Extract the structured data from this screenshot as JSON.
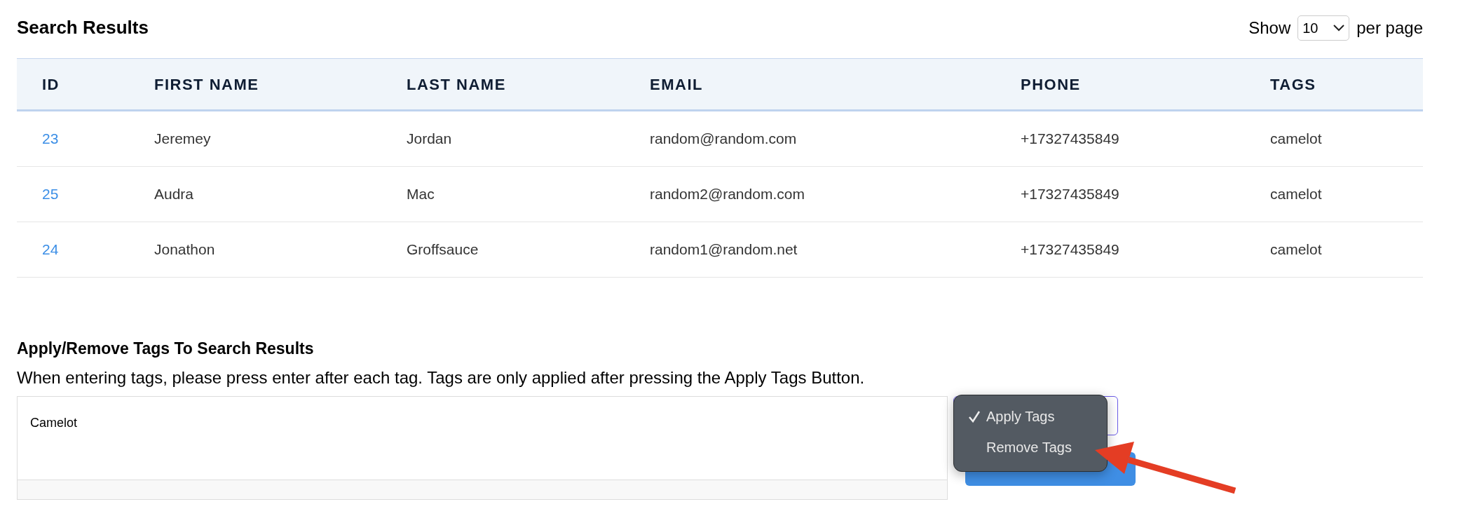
{
  "title": "Search Results",
  "page_size": {
    "prefix": "Show",
    "value": "10",
    "suffix": "per page"
  },
  "table": {
    "columns": [
      "ID",
      "FIRST NAME",
      "LAST NAME",
      "EMAIL",
      "PHONE",
      "TAGS"
    ],
    "rows": [
      {
        "id": "23",
        "first": "Jeremey",
        "last": "Jordan",
        "email": "random@random.com",
        "phone": "+17327435849",
        "tags": "camelot"
      },
      {
        "id": "25",
        "first": "Audra",
        "last": "Mac",
        "email": "random2@random.com",
        "phone": "+17327435849",
        "tags": "camelot"
      },
      {
        "id": "24",
        "first": "Jonathon",
        "last": "Groffsauce",
        "email": "random1@random.net",
        "phone": "+17327435849",
        "tags": "camelot"
      }
    ]
  },
  "tags_section": {
    "heading": "Apply/Remove Tags To Search Results",
    "note": "When entering tags, please press enter after each tag. Tags are only applied after pressing the Apply Tags Button.",
    "tags_value": "Camelot",
    "action_menu": [
      {
        "label": "Apply Tags",
        "selected": true
      },
      {
        "label": "Remove Tags",
        "selected": false
      }
    ]
  }
}
